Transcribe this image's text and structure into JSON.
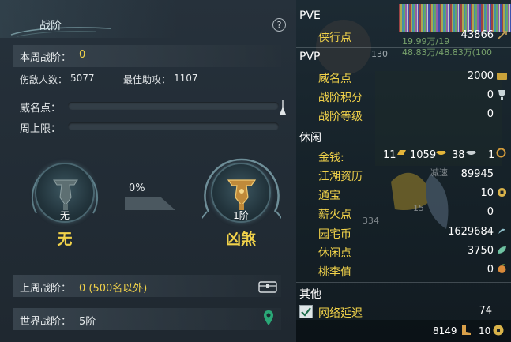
{
  "left": {
    "title": "战阶",
    "help_icon": "?",
    "weekly_rank_label": "本周战阶：",
    "weekly_rank_value": "0",
    "enemies_label": "伤敌人数：",
    "enemies_value": "5077",
    "assists_label": "最佳助攻：",
    "assists_value": "1107",
    "fame_label": "威名点：",
    "fame_progress": 0,
    "weekly_cap_label": "周上限：",
    "weekly_cap_progress": 0,
    "current_rank_small": "无",
    "current_rank_big": "无",
    "progress_percent": "0%",
    "next_rank_small": "1阶",
    "next_rank_big": "凶煞",
    "last_week_label": "上周战阶：",
    "last_week_value": "0 (500名以外)",
    "world_rank_label": "世界战阶：",
    "world_rank_value": "5阶",
    "icons": [
      "help-icon",
      "flag-icon",
      "chest-icon",
      "location-pin-icon",
      "rank-emblem-icon"
    ]
  },
  "right": {
    "pve_header": "PVE",
    "pve_items": [
      {
        "label": "侠行点",
        "value": "43866"
      }
    ],
    "pvp_header": "PVP",
    "pvp_items": [
      {
        "label": "威名点",
        "value": "2000"
      },
      {
        "label": "战阶积分",
        "value": "0"
      },
      {
        "label": "战阶等级",
        "value": "0"
      }
    ],
    "leisure_header": "休闲",
    "money_label": "金钱:",
    "money_gold": "11",
    "money_ingot": "1059",
    "money_silver": "38",
    "money_copper": "1",
    "leisure_items": [
      {
        "label": "江湖资历",
        "value": "89945"
      },
      {
        "label": "通宝",
        "value": "10"
      },
      {
        "label": "薪火点",
        "value": "0"
      },
      {
        "label": "园宅币",
        "value": "1629684"
      },
      {
        "label": "休闲点",
        "value": "3750"
      },
      {
        "label": "桃李值",
        "value": "0"
      }
    ],
    "other_header": "其他",
    "net_delay_label": "网络延迟",
    "net_delay_value": "74",
    "net_delay_checked": true,
    "footer_left_value": "8149",
    "footer_right_value": "10",
    "background_text": {
      "hp1": "19.99万/19",
      "hp2": "48.83万/48.83万(100",
      "level": "130",
      "slow": "减速",
      "num15": "15",
      "num334": "334"
    }
  },
  "colors": {
    "accent_yellow": "#f1d24a",
    "panel_bg": "#222c35",
    "text_light": "#e4e8ea"
  }
}
